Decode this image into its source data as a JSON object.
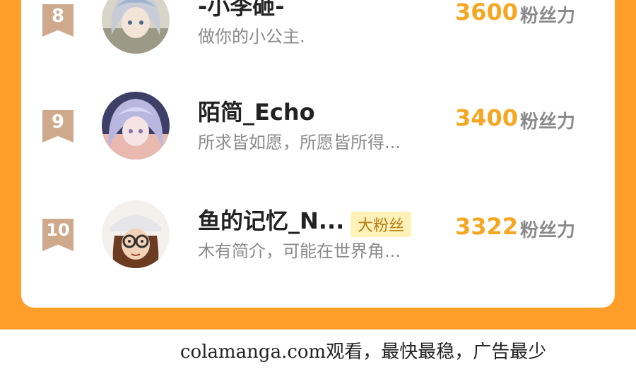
{
  "leaderboard": [
    {
      "rank": "8",
      "name": "-小李砸-",
      "bio": "做你的小公主.",
      "tag": "",
      "score": "3600",
      "unit": "粉丝力",
      "avatar_icon": "avatar-girl-silver-hair-icon"
    },
    {
      "rank": "9",
      "name": "陌简_Echo",
      "bio": "所求皆如愿，所愿皆所得...",
      "tag": "",
      "score": "3400",
      "unit": "粉丝力",
      "avatar_icon": "avatar-anime-lavender-hair-icon"
    },
    {
      "rank": "10",
      "name": "鱼的记忆_N...",
      "bio": "木有简介，可能在世界角...",
      "tag": "大粉丝",
      "score": "3322",
      "unit": "粉丝力",
      "avatar_icon": "avatar-glasses-cap-icon"
    }
  ],
  "footer": {
    "text": "colamanga.com观看，最快最稳，广告最少"
  },
  "colors": {
    "frame": "#ff9f2a",
    "score": "#f5a623",
    "badge": "#cfa98b",
    "tag_bg": "#fff1b8"
  }
}
